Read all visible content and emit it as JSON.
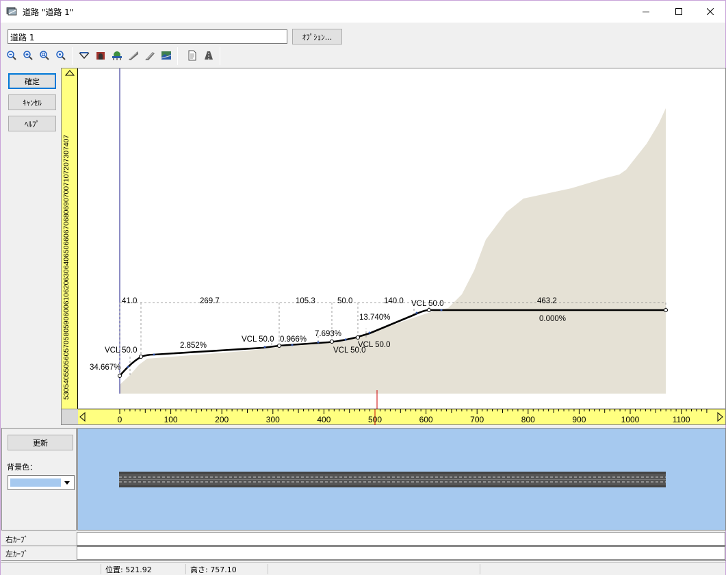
{
  "window": {
    "title": "道路 \"道路 1\"",
    "controls": [
      "minimize",
      "maximize",
      "close"
    ]
  },
  "header": {
    "road_name": "道路 1",
    "options_label": "ｵﾌﾟｼｮﾝ..."
  },
  "toolbar": {
    "icons": [
      "zoom-out-icon",
      "zoom-in-icon",
      "zoom-fit-icon",
      "zoom-window-icon",
      "valley-icon",
      "tunnel-icon",
      "bridge-icon",
      "cut-slope-icon",
      "fill-slope-icon",
      "terrain-icon",
      "document-icon",
      "road-section-icon"
    ]
  },
  "side_buttons": {
    "ok_label": "確定",
    "cancel_label": "ｷｬﾝｾﾙ",
    "help_label": "ﾍﾙﾌﾟ"
  },
  "profile": {
    "x_ticks": [
      0,
      100,
      200,
      300,
      400,
      500,
      600,
      700,
      800,
      900,
      1000,
      1100
    ],
    "y_ruler_text": "5305405505605705805906006106206306406506606706806907007107207307407",
    "marker_x": 500,
    "segment_lengths": [
      {
        "x": 3,
        "text": "41.0"
      },
      {
        "x": 31.5,
        "text": "269.7"
      },
      {
        "x": 54.0,
        "text": "105.3"
      },
      {
        "x": 63,
        "text": "50.0"
      },
      {
        "x": 90,
        "text": "140.0"
      },
      {
        "x": 120,
        "text": "463.2"
      }
    ],
    "grades": [
      {
        "text": "34.667%"
      },
      {
        "text": "2.852%"
      },
      {
        "text": "0.966%"
      },
      {
        "text": "7.693%"
      },
      {
        "text": "13.740%"
      },
      {
        "text": "0.000%"
      }
    ],
    "vcl_labels": [
      "VCL  50.0",
      "VCL  50.0",
      "VCL  50.0",
      "VCL  50.0",
      "VCL  50.0"
    ]
  },
  "plan": {
    "update_label": "更新",
    "bg_label": "背景色：",
    "bg_color": "#a6c9ef"
  },
  "curves": {
    "right_label": "右ｶｰﾌﾞ",
    "left_label": "左ｶｰﾌﾞ"
  },
  "status": {
    "position": "位置: 521.92",
    "height": "高さ: 757.10"
  }
}
